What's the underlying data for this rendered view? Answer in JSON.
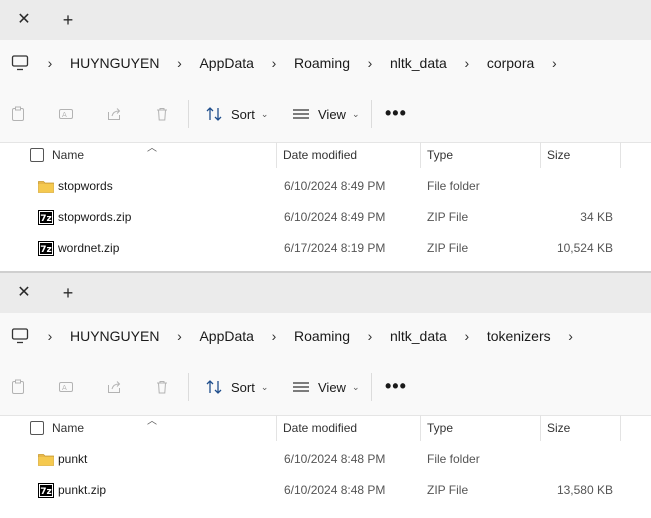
{
  "colors": {
    "folder": "#e8b84a",
    "tabbar": "#ebebeb",
    "bar": "#f9f9f9"
  },
  "tab": {
    "close_icon": "close-icon",
    "new_icon": "plus-icon"
  },
  "toolbar": {
    "sort_label": "Sort",
    "view_label": "View",
    "more_label": "•••"
  },
  "columns": {
    "name": "Name",
    "date": "Date modified",
    "type": "Type",
    "size": "Size"
  },
  "windows": [
    {
      "breadcrumb": [
        "HUYNGUYEN",
        "AppData",
        "Roaming",
        "nltk_data",
        "corpora"
      ],
      "files": [
        {
          "icon": "folder-icon",
          "name": "stopwords",
          "date": "6/10/2024 8:49 PM",
          "type": "File folder",
          "size": ""
        },
        {
          "icon": "7z-archive-icon",
          "name": "stopwords.zip",
          "date": "6/10/2024 8:49 PM",
          "type": "ZIP File",
          "size": "34 KB"
        },
        {
          "icon": "7z-archive-icon",
          "name": "wordnet.zip",
          "date": "6/17/2024 8:19 PM",
          "type": "ZIP File",
          "size": "10,524 KB"
        }
      ]
    },
    {
      "breadcrumb": [
        "HUYNGUYEN",
        "AppData",
        "Roaming",
        "nltk_data",
        "tokenizers"
      ],
      "files": [
        {
          "icon": "folder-icon",
          "name": "punkt",
          "date": "6/10/2024 8:48 PM",
          "type": "File folder",
          "size": ""
        },
        {
          "icon": "7z-archive-icon",
          "name": "punkt.zip",
          "date": "6/10/2024 8:48 PM",
          "type": "ZIP File",
          "size": "13,580 KB"
        }
      ]
    }
  ]
}
